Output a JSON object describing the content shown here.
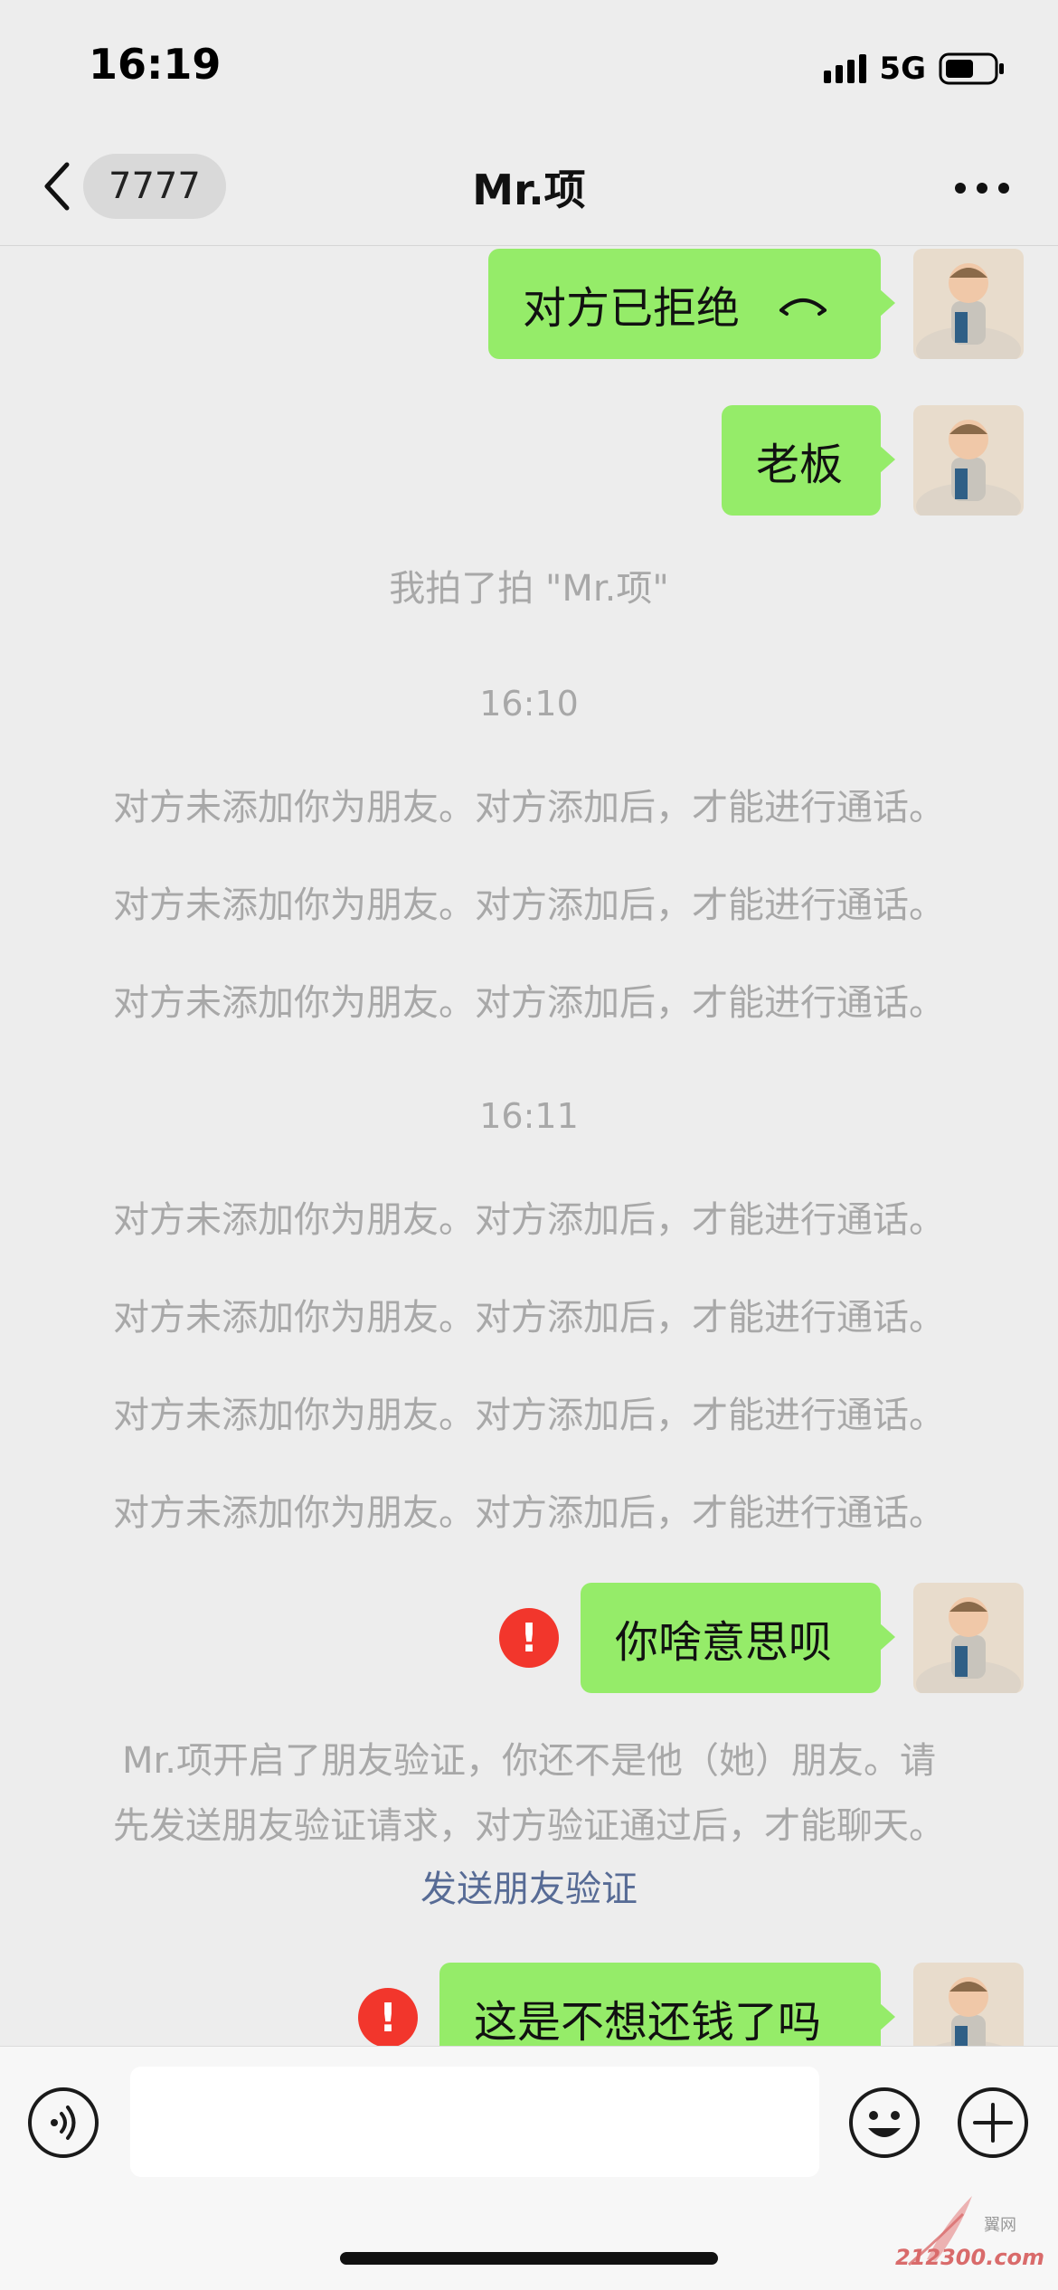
{
  "status_bar": {
    "time": "16:19",
    "network": "5G"
  },
  "nav": {
    "unread_count": "7777",
    "title": "Mr.项"
  },
  "messages": {
    "call_declined": "对方已拒绝",
    "boss": "老板",
    "pat_notice": "我拍了拍 \"Mr.项\"",
    "time_1": "16:10",
    "time_2": "16:11",
    "not_friend_call_1": "对方未添加你为朋友。对方添加后，才能进行通话。",
    "not_friend_call_2": "对方未添加你为朋友。对方添加后，才能进行通话。",
    "not_friend_call_3": "对方未添加你为朋友。对方添加后，才能进行通话。",
    "not_friend_call_4": "对方未添加你为朋友。对方添加后，才能进行通话。",
    "not_friend_call_5": "对方未添加你为朋友。对方添加后，才能进行通话。",
    "not_friend_call_6": "对方未添加你为朋友。对方添加后，才能进行通话。",
    "not_friend_call_7": "对方未添加你为朋友。对方添加后，才能进行通话。",
    "what_do_you_mean": "你啥意思呗",
    "verify_line_1": "Mr.项开启了朋友验证，你还不是他（她）朋友。请",
    "verify_line_2": "先发送朋友验证请求，对方验证通过后，才能聊天。",
    "send_verify_link": "发送朋友验证",
    "not_paying_back": "这是不想还钱了吗",
    "failed_mark": "!"
  },
  "watermark": {
    "site": "212300.com",
    "cn": "翼网"
  },
  "colors": {
    "background": "#ededed",
    "bubble_green": "#95ec69",
    "error_red": "#f2362c",
    "link_blue": "#576b95",
    "system_gray": "#a8a8a8"
  },
  "icons": [
    "back-icon",
    "more-icon",
    "hangup-icon",
    "error-icon",
    "voice-icon",
    "emoji-icon",
    "plus-icon",
    "signal-icon",
    "battery-icon"
  ]
}
